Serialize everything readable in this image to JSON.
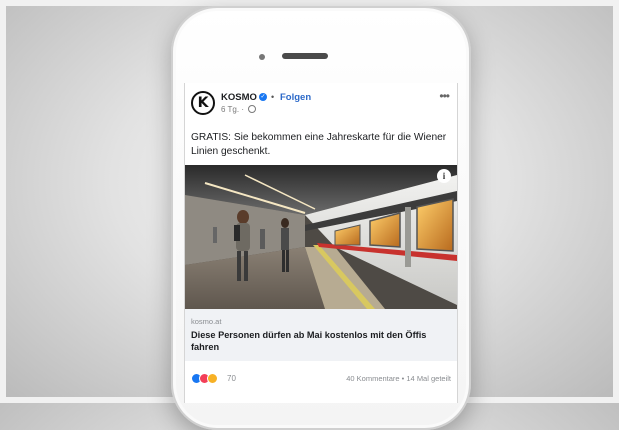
{
  "post": {
    "page_name": "KOSMO",
    "avatar_letter": "K",
    "separator": "•",
    "follow_label": "Folgen",
    "time": "6 Tg.",
    "time_separator": "·",
    "more_label": "•••",
    "text": "GRATIS: Sie bekommen eine Jahreskarte für die Wiener Linien geschenkt.",
    "info_label": "i"
  },
  "link_preview": {
    "domain": "kosmo.at",
    "title": "Diese Personen dürfen ab Mai kostenlos mit den Öffis fahren"
  },
  "engagement": {
    "reaction_count": "70",
    "comments_shares": "40 Kommentare • 14 Mal geteilt"
  },
  "colors": {
    "accent": "#1877f2",
    "follow": "#2d6ac9",
    "train_red": "#c8322e"
  },
  "icons": [
    "verified-icon",
    "globe-icon",
    "more-icon",
    "info-icon",
    "like-icon",
    "love-icon",
    "haha-icon"
  ]
}
